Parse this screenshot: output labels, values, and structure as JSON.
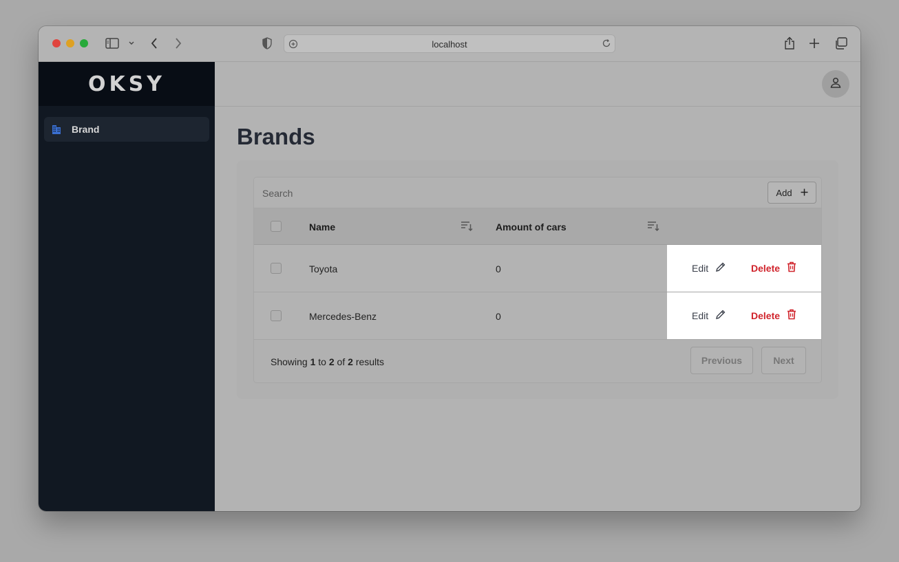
{
  "browser": {
    "url": "localhost",
    "icons": [
      "sidebar-toggle-icon",
      "chevron-down-icon",
      "back-icon",
      "forward-icon",
      "shield-icon",
      "site-info-icon",
      "reload-icon",
      "share-icon",
      "new-tab-icon",
      "tabs-overview-icon"
    ]
  },
  "sidebar": {
    "logo": "OKSY",
    "items": [
      {
        "label": "Brand",
        "icon": "building-icon",
        "active": true
      }
    ]
  },
  "header": {
    "avatar_icon": "user-icon"
  },
  "page": {
    "title": "Brands"
  },
  "toolbar": {
    "search_placeholder": "Search",
    "add_label": "Add"
  },
  "table": {
    "columns": [
      "Name",
      "Amount of cars"
    ],
    "rows": [
      {
        "name": "Toyota",
        "amount": "0"
      },
      {
        "name": "Mercedes-Benz",
        "amount": "0"
      }
    ],
    "edit_label": "Edit",
    "delete_label": "Delete"
  },
  "pagination": {
    "showing_prefix": "Showing",
    "from": "1",
    "to_word": "to",
    "to": "2",
    "of_word": "of",
    "total": "2",
    "results_word": "results",
    "previous_label": "Previous",
    "next_label": "Next"
  },
  "colors": {
    "sidebar_bg": "#111822",
    "delete_red": "#d0232b",
    "title_text": "#252a35"
  }
}
